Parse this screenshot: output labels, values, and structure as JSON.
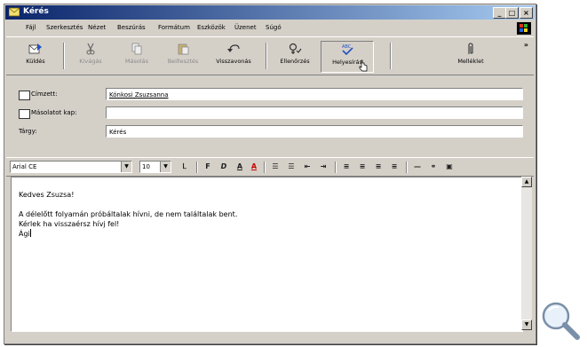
{
  "window": {
    "title": "Kérés"
  },
  "title_buttons": {
    "minimize": "_",
    "maximize": "□",
    "close": "×"
  },
  "menu": [
    "Fájl",
    "Szerkesztés",
    "Nézet",
    "Beszúrás",
    "Formátum",
    "Eszközök",
    "Üzenet",
    "Súgó"
  ],
  "toolbar": {
    "send": "Küldés",
    "cut": "Kivágás",
    "copy": "Másolás",
    "paste": "Beillesztés",
    "undo": "Visszavonás",
    "check": "Ellenőrzés",
    "spelling": "Helyesírás",
    "attach": "Melléklet",
    "more": "»"
  },
  "fields": {
    "to_label": "Címzett:",
    "to_value": "Kónkosi Zsuzsanna",
    "cc_label": "Másolatot kap:",
    "cc_value": "",
    "subject_label": "Tárgy:",
    "subject_value": "Kérés"
  },
  "format": {
    "font": "Arial CE",
    "size": "10"
  },
  "message": {
    "lines": [
      "Kedves Zsuzsa!",
      "",
      "A délelőtt folyamán próbáltalak hívni, de nem találtalak bent.",
      "Kérlek ha visszaérsz hívj fel!",
      "Ági"
    ]
  },
  "colors": {
    "title_start": "#0a246a",
    "title_end": "#a6caf0",
    "chrome": "#d4d0c8"
  }
}
